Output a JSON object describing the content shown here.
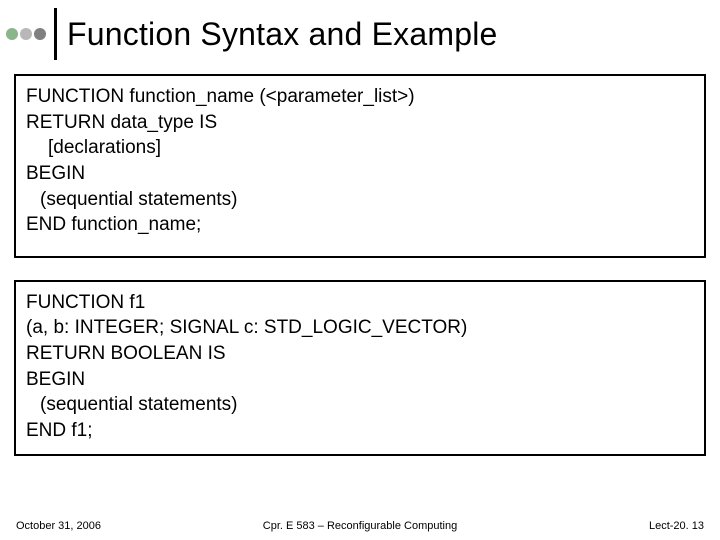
{
  "title": "Function Syntax and Example",
  "box1": {
    "l1": "FUNCTION function_name (<parameter_list>)",
    "l2": "RETURN data_type IS",
    "l3": "[declarations]",
    "l4": "BEGIN",
    "l5": "(sequential statements)",
    "l6": "END function_name;"
  },
  "box2": {
    "l1": "FUNCTION f1",
    "l2": " (a, b: INTEGER; SIGNAL c: STD_LOGIC_VECTOR)",
    "l3": "RETURN BOOLEAN IS",
    "l4": "BEGIN",
    "l5": "(sequential statements)",
    "l6": "END f1;"
  },
  "footer": {
    "left": "October 31, 2006",
    "center": "Cpr. E 583 – Reconfigurable Computing",
    "right": "Lect-20. 13"
  }
}
